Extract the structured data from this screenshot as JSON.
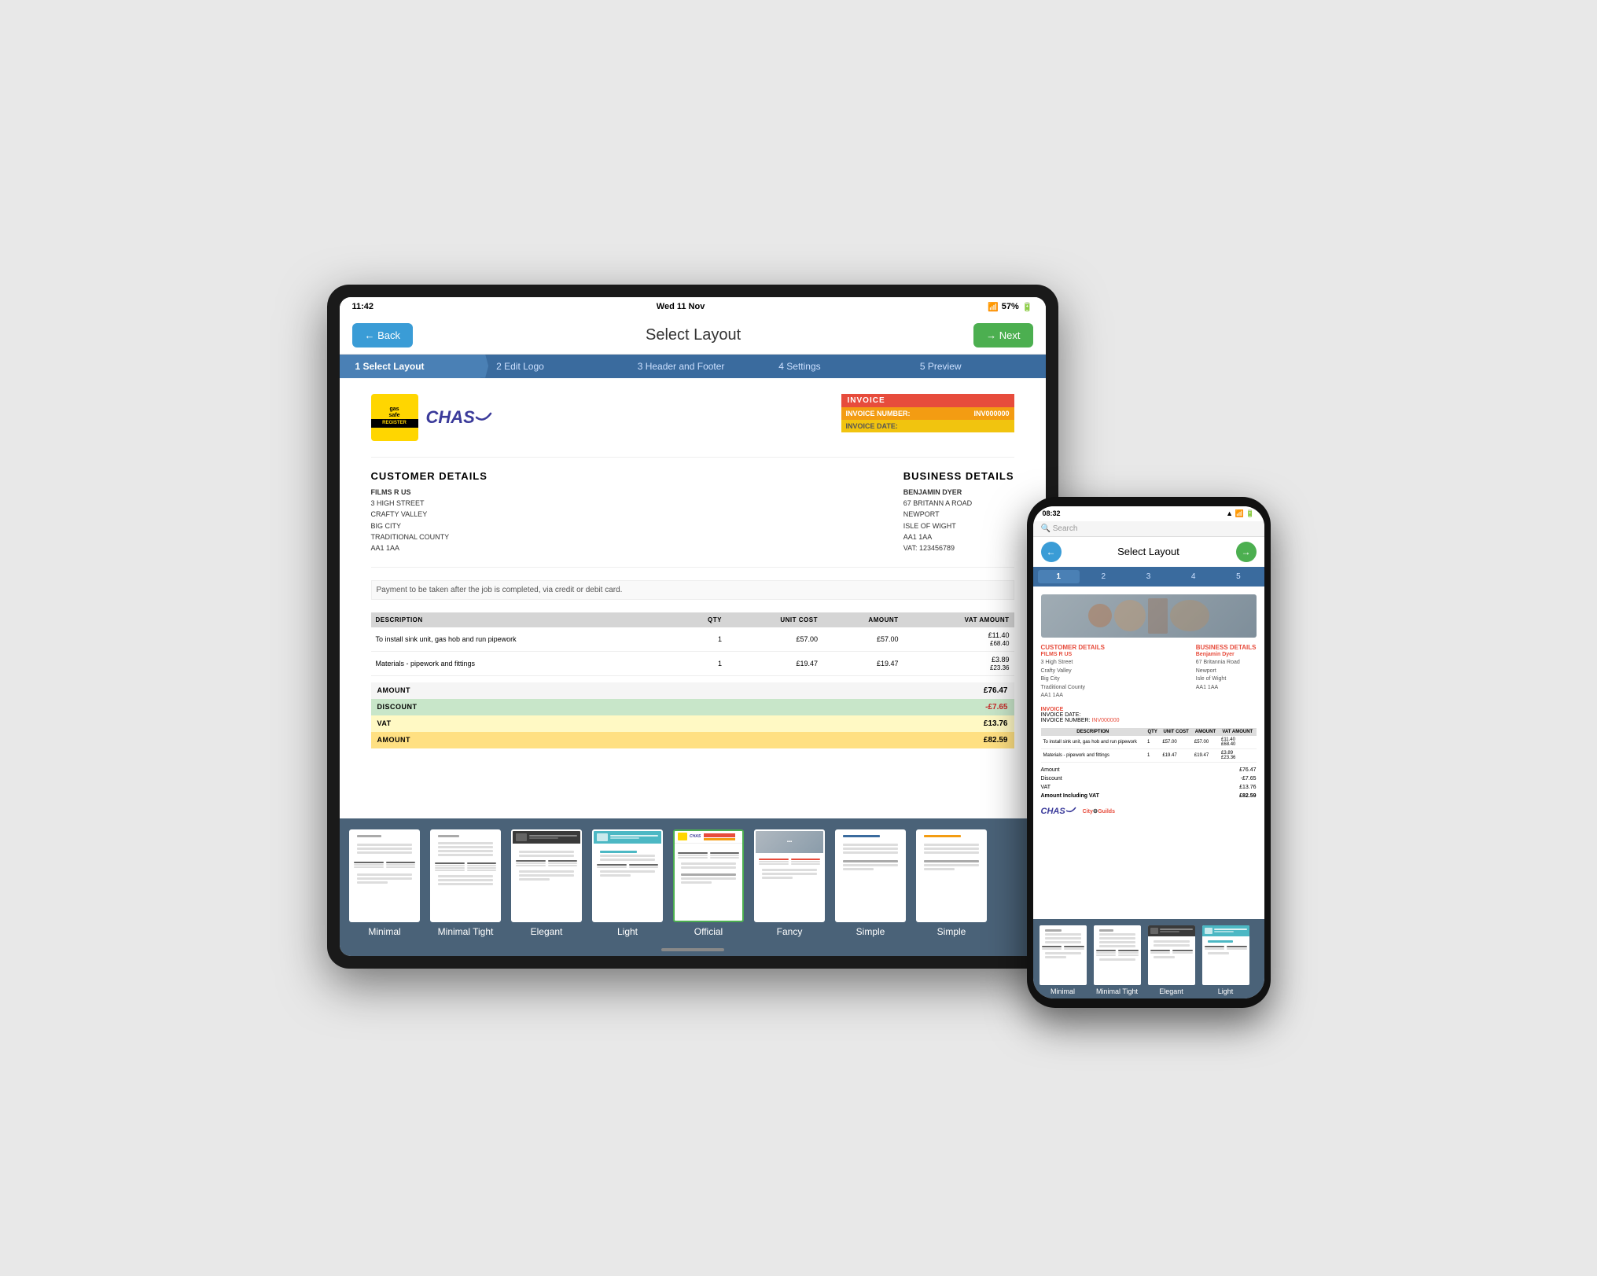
{
  "scene": {
    "tablet": {
      "status_bar": {
        "time": "11:42",
        "date": "Wed 11 Nov",
        "battery": "57%"
      },
      "header": {
        "back_label": "← Back",
        "title": "Select Layout",
        "next_label": "→ Next"
      },
      "progress_steps": [
        {
          "id": 1,
          "label": "1 Select Layout",
          "active": true
        },
        {
          "id": 2,
          "label": "2 Edit Logo",
          "active": false
        },
        {
          "id": 3,
          "label": "3 Header and Footer",
          "active": false
        },
        {
          "id": 4,
          "label": "4 Settings",
          "active": false
        },
        {
          "id": 5,
          "label": "5 Preview",
          "active": false
        }
      ],
      "invoice": {
        "company_name": "CHAS",
        "invoice_label": "INVOICE",
        "invoice_number_label": "INVOICE NUMBER:",
        "invoice_number_value": "INV000000",
        "invoice_date_label": "INVOICE DATE:",
        "customer_details_title": "CUSTOMER DETAILS",
        "customer_name": "FILMS R US",
        "customer_address": "3 HIGH STREET\nCRAFTY VALLEY\nBIG CITY\nTRADITIONAL COUNTY\nAA1 1AA",
        "business_details_title": "BUSINESS DETAILS",
        "business_name": "BENJAMIN DYER",
        "business_address": "67 BRITANN A ROAD\nNEWPORT\nISLE OF WIGHT\nAA1 1AA\nVAT: 123456789",
        "payment_note": "Payment to be taken after the job is completed, via credit or debit card.",
        "table_headers": [
          "DESCRIPTION",
          "QTY",
          "UNIT COST",
          "AMOUNT",
          "VAT AMOUNT"
        ],
        "line_items": [
          {
            "desc": "To install sink unit, gas hob and run pipework",
            "qty": "1",
            "unit": "£57.00",
            "amount": "£57.00",
            "vat": "£11.40",
            "total": "£68.40"
          },
          {
            "desc": "Materials - pipework and fittings",
            "qty": "1",
            "unit": "£19.47",
            "amount": "£19.47",
            "vat": "£3.89",
            "total": "£23.36"
          }
        ],
        "totals": {
          "amount_label": "AMOUNT",
          "amount_value": "£76.47",
          "discount_label": "DISCOUNT",
          "discount_value": "-£7.65",
          "vat_label": "VAT",
          "vat_value": "£13.76",
          "total_label": "AMOUNT",
          "total_value": "£82.59"
        }
      },
      "layouts": [
        {
          "id": "minimal",
          "label": "Minimal",
          "active": false
        },
        {
          "id": "minimal-tight",
          "label": "Minimal Tight",
          "active": false
        },
        {
          "id": "elegant",
          "label": "Elegant",
          "active": false
        },
        {
          "id": "light",
          "label": "Light",
          "active": false
        },
        {
          "id": "official",
          "label": "Official",
          "active": true
        },
        {
          "id": "fancy",
          "label": "Fancy",
          "active": false
        },
        {
          "id": "simple",
          "label": "Simple",
          "active": false
        },
        {
          "id": "simple2",
          "label": "Simple",
          "active": false
        }
      ]
    },
    "phone": {
      "status_bar": {
        "time": "08:32",
        "signal": "4G"
      },
      "search_placeholder": "Search",
      "header": {
        "title": "Select Layout",
        "back_label": "←",
        "next_label": "→"
      },
      "steps": [
        "1",
        "2",
        "3",
        "4",
        "5"
      ],
      "invoice": {
        "customer_title": "CUSTOMER DETAILS",
        "business_title": "BUSINESS DETAILS",
        "customer_name": "FILMS R US",
        "customer_address": "3 High Street\nCrafty Valley\nBig City\nTraditional County\nAA1 1AA",
        "business_name": "Benjamin Dyer",
        "business_address": "67 Britannia Road\nNewport\nIsle of Wight\nAA1 1AA",
        "invoice_label": "INVOICE",
        "invoice_date_label": "INVOICE DATE:",
        "invoice_number_label": "INVOICE NUMBER:",
        "invoice_number": "INV000000",
        "line_items": [
          {
            "desc": "To install sink unit, gas hob and run pipework",
            "qty": "1",
            "unit": "£57.00",
            "amount": "£57.00",
            "vat": "£11.40",
            "total": "£68.40"
          },
          {
            "desc": "Materials - pipework and fittings",
            "qty": "1",
            "unit": "£19.47",
            "amount": "£19.47",
            "vat": "£3.89",
            "total": "£23.36"
          }
        ],
        "amount": "£76.47",
        "discount": "-£7.65",
        "vat": "£13.76",
        "total": "£82.59",
        "company_logos": [
          "CHAS",
          "City & Guilds"
        ]
      },
      "layouts": [
        {
          "id": "minimal",
          "label": "Minimal"
        },
        {
          "id": "minimal-tight",
          "label": "Minimal Tight"
        },
        {
          "id": "elegant",
          "label": "Elegant"
        },
        {
          "id": "light",
          "label": "Light"
        }
      ]
    }
  }
}
